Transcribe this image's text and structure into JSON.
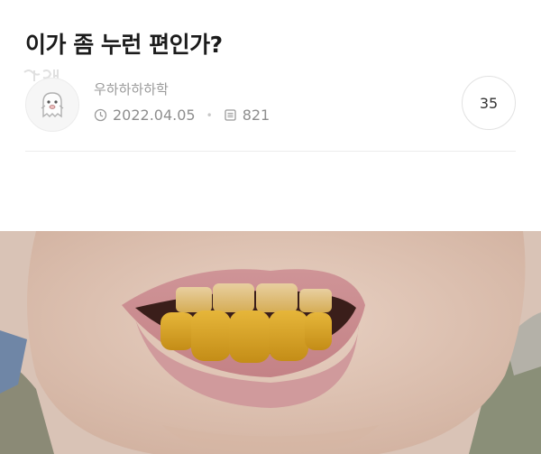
{
  "post": {
    "title": "이가 좀 누런 편인가?",
    "author": "우하하하하학",
    "date": "2022.04.05",
    "views": "821",
    "comment_count": "35"
  },
  "watermark": "여시",
  "icons": {
    "date": "clock-icon",
    "views": "view-count-icon",
    "avatar": "ghost-character-icon"
  },
  "colors": {
    "title": "#1b1b1b",
    "meta": "#8e8e8e",
    "skin": "#e3c8b8",
    "lips": "#c98c8e",
    "teeth": "#d4a11e"
  }
}
